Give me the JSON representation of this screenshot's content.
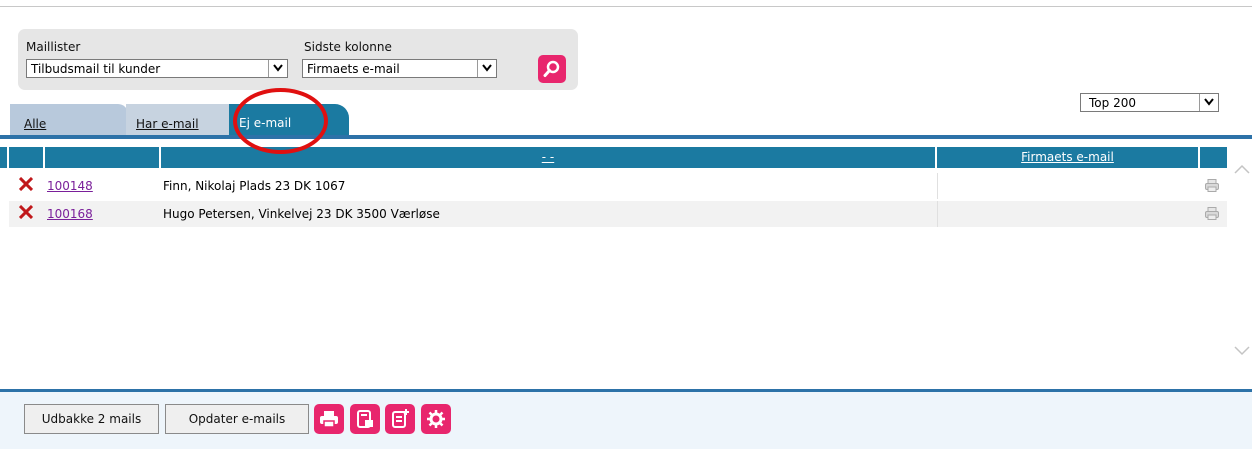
{
  "filters": {
    "maillister_label": "Maillister",
    "maillister_value": "Tilbudsmail til kunder",
    "sidste_kolonne_label": "Sidste kolonne",
    "sidste_kolonne_value": "Firmaets e-mail"
  },
  "top_select": {
    "value": "Top 200"
  },
  "tabs": [
    {
      "label": "Alle",
      "active": false
    },
    {
      "label": "Har e-mail",
      "active": false
    },
    {
      "label": "Ej e-mail",
      "active": true
    }
  ],
  "table": {
    "headers": [
      "",
      "",
      "- -",
      "Firmaets e-mail",
      ""
    ],
    "rows": [
      {
        "id": "100148",
        "address": "Finn, Nikolaj Plads 23 DK 1067",
        "email": ""
      },
      {
        "id": "100168",
        "address": "Hugo Petersen, Vinkelvej 23 DK 3500 Værløse",
        "email": ""
      }
    ]
  },
  "footer": {
    "udbakke_label": "Udbakke 2 mails",
    "opdater_label": "Opdater e-mails",
    "icons": [
      "print-icon",
      "document-lock-icon",
      "document-add-icon",
      "gear-icon"
    ]
  },
  "colors": {
    "accent": "#e8266d",
    "header_blue": "#1b7aa1",
    "rule_blue": "#2d72a8",
    "delete_red": "#c0181b",
    "annotation_red": "#e01010"
  },
  "icons": {
    "search": "search-icon",
    "delete": "delete-x-icon",
    "printer": "printer-icon",
    "dropdown": "chevron-down-icon"
  }
}
